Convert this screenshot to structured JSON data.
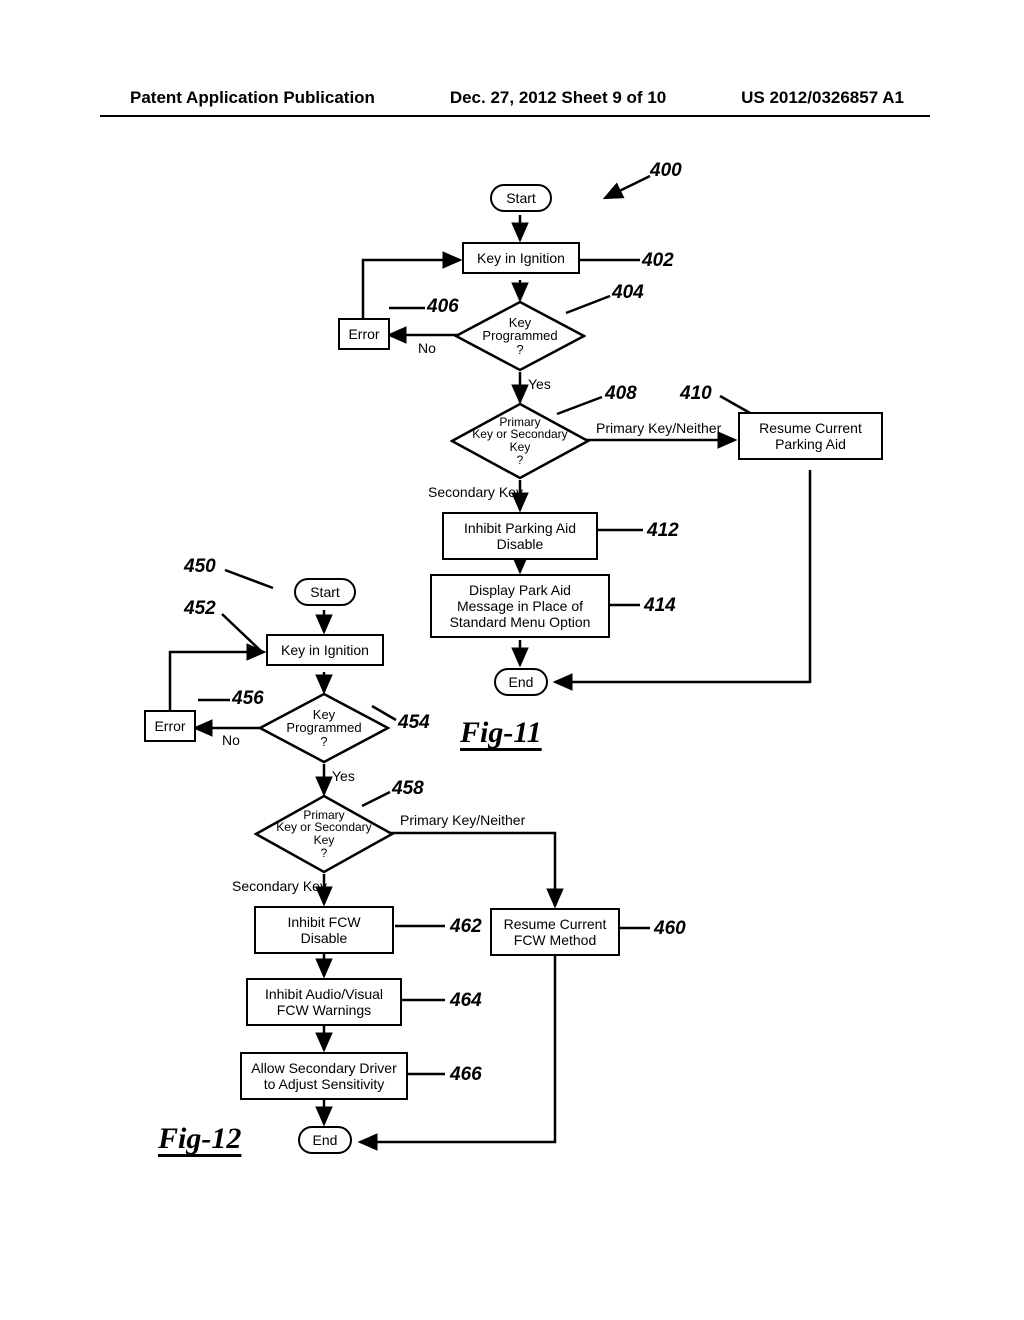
{
  "header": {
    "left": "Patent Application Publication",
    "center": "Dec. 27, 2012  Sheet 9 of 10",
    "right": "US 2012/0326857 A1"
  },
  "fig11": {
    "start": "Start",
    "n402": "Key in Ignition",
    "n404": "Key\nProgrammed\n?",
    "n406": "Error",
    "n408": "Primary\nKey or Secondary\nKey\n?",
    "n410": "Resume Current\nParking Aid",
    "n412": "Inhibit Parking Aid\nDisable",
    "n414": "Display Park Aid Message\nin Place of Standard\nMenu Option",
    "end": "End",
    "label_no": "No",
    "label_yes": "Yes",
    "label_pk": "Primary Key/Neither",
    "label_sk": "Secondary Key",
    "ref400": "400",
    "ref402": "402",
    "ref404": "404",
    "ref406": "406",
    "ref408": "408",
    "ref410": "410",
    "ref412": "412",
    "ref414": "414",
    "caption": "Fig-11"
  },
  "fig12": {
    "start": "Start",
    "n452": "Key in Ignition",
    "n454": "Key\nProgrammed\n?",
    "n456": "Error",
    "n458": "Primary\nKey or Secondary\nKey\n?",
    "n460": "Resume Current\nFCW Method",
    "n462": "Inhibit FCW\nDisable",
    "n464": "Inhibit Audio/Visual\nFCW Warnings",
    "n466": "Allow Secondary Driver\nto Adjust Sensitivity",
    "end": "End",
    "label_no": "No",
    "label_yes": "Yes",
    "label_pk": "Primary Key/Neither",
    "label_sk": "Secondary Key",
    "ref450": "450",
    "ref452": "452",
    "ref454": "454",
    "ref456": "456",
    "ref458": "458",
    "ref460": "460",
    "ref462": "462",
    "ref464": "464",
    "ref466": "466",
    "caption": "Fig-12"
  }
}
